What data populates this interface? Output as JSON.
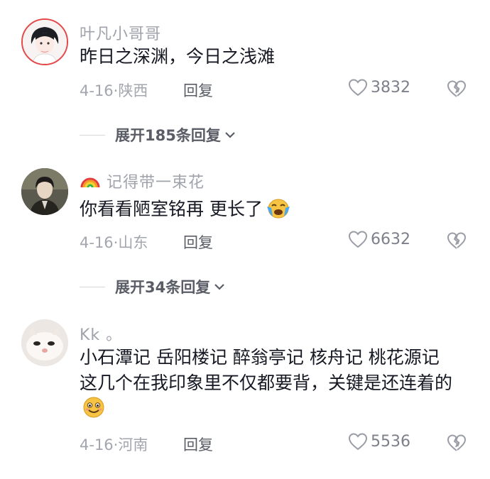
{
  "comments": [
    {
      "username": "叶凡小哥哥",
      "text": "昨日之深渊，今日之浅滩",
      "meta": "4-16·陕西",
      "reply_label": "回复",
      "likes": "3832",
      "expand_label": "展开185条回复"
    },
    {
      "username_prefix_icon": "rainbow-icon",
      "username": "记得带一束花",
      "text": "你看看陋室铭再 更长了",
      "text_emoji": "crying-face-icon",
      "meta": "4-16·山东",
      "reply_label": "回复",
      "likes": "6632",
      "expand_label": "展开34条回复"
    },
    {
      "username": "Kk 。",
      "text": "小石潭记  岳阳楼记  醉翁亭记  核舟记  桃花源记    这几个在我印象里不仅都要背，关键是还连着的",
      "text_emoji": "smiling-face-icon",
      "meta": "4-16·河南",
      "reply_label": "回复",
      "likes": "5536"
    }
  ],
  "colors": {
    "username": "#a0a3ab",
    "content": "#161823",
    "meta": "#a3a6ae",
    "action": "#5a5d66"
  }
}
